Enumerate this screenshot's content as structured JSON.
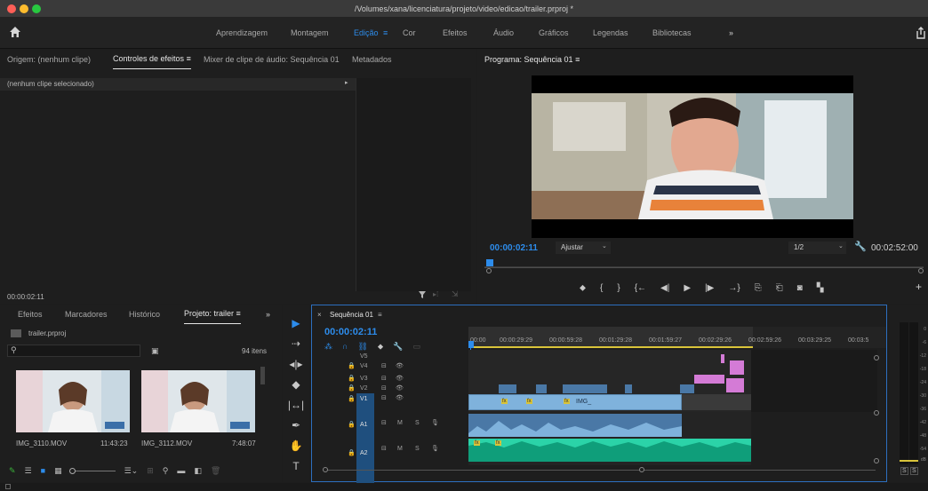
{
  "window": {
    "title": "/Volumes/xana/licenciatura/projeto/video/edicao/trailer.prproj *"
  },
  "workspaces": {
    "items": [
      "Aprendizagem",
      "Montagem",
      "Edição",
      "Cor",
      "Efeitos",
      "Áudio",
      "Gráficos",
      "Legendas",
      "Bibliotecas"
    ],
    "active": "Edição",
    "more": "»"
  },
  "source_panel": {
    "tabs": [
      "Origem: (nenhum clipe)",
      "Controles de efeitos",
      "Mixer de clipe de áudio: Sequência 01",
      "Metadados"
    ],
    "active_tab_menu": "≡",
    "no_clip": "(nenhum clipe selecionado)",
    "timecode": "00:00:02:11"
  },
  "program_panel": {
    "title": "Programa: Sequência 01",
    "menu": "≡",
    "timecode": "00:00:02:11",
    "fit": "Ajustar",
    "resolution": "1/2",
    "duration": "00:02:52:00"
  },
  "project_panel": {
    "tabs": [
      "Efeitos",
      "Marcadores",
      "Histórico",
      "Projeto: trailer"
    ],
    "active_menu": "≡",
    "more": "»",
    "file": "trailer.prproj",
    "item_count": "94 itens",
    "clips": [
      {
        "name": "IMG_3110.MOV",
        "duration": "11:43:23"
      },
      {
        "name": "IMG_3112.MOV",
        "duration": "7:48:07"
      }
    ]
  },
  "timeline": {
    "tab": "Sequência 01",
    "close": "×",
    "menu": "≡",
    "timecode": "00:00:02:11",
    "ruler": [
      "00:00",
      "00:00:29:29",
      "00:00:59:28",
      "00:01:29:28",
      "00:01:59:27",
      "00:02:29:26",
      "00:02:59:26",
      "00:03:29:25",
      "00:03:5"
    ],
    "video_tracks": [
      "V5",
      "V4",
      "V3",
      "V2",
      "V1"
    ],
    "audio_tracks": [
      "A1",
      "A2"
    ],
    "track_toggles": {
      "mute": "M",
      "solo": "S"
    },
    "clip_label": "IMG_",
    "fx": "fx"
  },
  "meter": {
    "solo": [
      "S",
      "S"
    ],
    "ticks": [
      "0",
      "-6",
      "-12",
      "-18",
      "-24",
      "-30",
      "-36",
      "-42",
      "-48",
      "-54",
      "dB"
    ]
  },
  "colors": {
    "accent": "#2d8ceb",
    "video_clip": "#7fb2dc",
    "pink_clip": "#d47bd6",
    "audio_wave": "#2bd3a8",
    "panel": "#1e1e1e"
  }
}
